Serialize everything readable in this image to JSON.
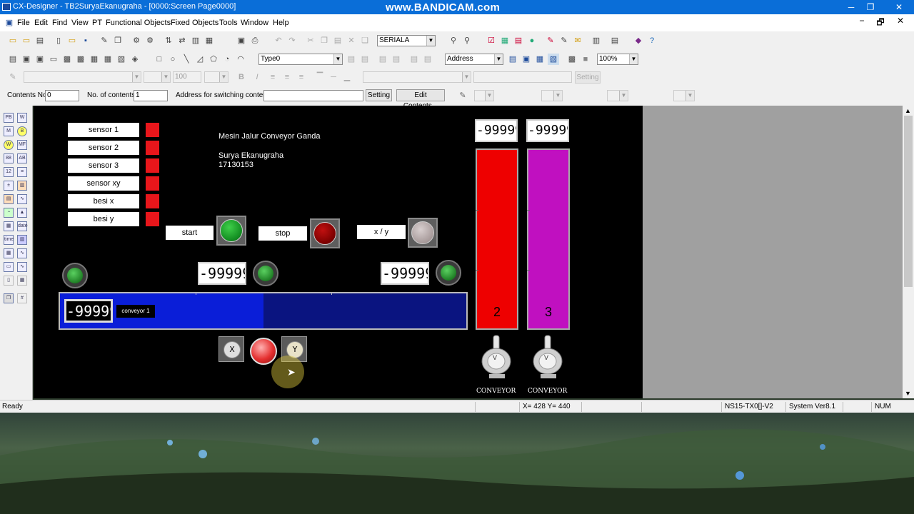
{
  "window": {
    "title": "CX-Designer - TB2SuryaEkanugraha - [0000:Screen Page0000]",
    "watermark": "www.BANDICAM.com",
    "minimize": "─",
    "restore": "❐",
    "close": "✕"
  },
  "menu": [
    "File",
    "Edit",
    "Find",
    "View",
    "PT",
    "Functional Objects",
    "Fixed Objects",
    "Tools",
    "Window",
    "Help"
  ],
  "mdi_buttons": [
    "−",
    "🗗",
    "✕"
  ],
  "toolbar1": {
    "port_select": "SERIALA"
  },
  "toolbar2": {
    "type_select": "Type0",
    "address_select": "Address",
    "zoom_select": "100%"
  },
  "toolbar3": {
    "font_size": "100",
    "setting_label": "Setting"
  },
  "toolbar4": {
    "contents_no_label": "Contents No.",
    "contents_no_value": "0",
    "no_of_contents_label": "No. of contents",
    "no_of_contents_value": "1",
    "address_switch_label": "Address for switching contents",
    "setting_button": "Setting",
    "edit_contents_button": "Edit Contents..."
  },
  "canvas": {
    "sensors": [
      {
        "label": "sensor 1"
      },
      {
        "label": "sensor 2"
      },
      {
        "label": "sensor 3"
      },
      {
        "label": "sensor xy"
      },
      {
        "label": "besi x"
      },
      {
        "label": "besi y"
      }
    ],
    "title_line": "Mesin Jalur Conveyor Ganda",
    "author": "Surya Ekanugraha",
    "student_id": "17130153",
    "start_label": "start",
    "stop_label": "stop",
    "xy_label": "x / y",
    "numeric_display": "-99999",
    "conveyor_label": "conveyor 1",
    "tank_left_number": "2",
    "tank_right_number": "3",
    "x_button": "X",
    "y_button": "Y",
    "switch_left_label": "CONVEYOR",
    "switch_right_label": "CONVEYOR",
    "switch_glyph": "V",
    "colors": {
      "sensor_lamp": "#e8161b",
      "start_green": "#1a9e2a",
      "stop_red": "#9a0000",
      "conveyor_blue": "#0a1ed8",
      "tank_red": "#ee0000",
      "tank_magenta": "#c010c0"
    }
  },
  "status": {
    "ready": "Ready",
    "coords": "X= 428 Y= 440",
    "device": "NS15-TX0[]-V2",
    "version": "System Ver8.1",
    "num": "NUM"
  }
}
